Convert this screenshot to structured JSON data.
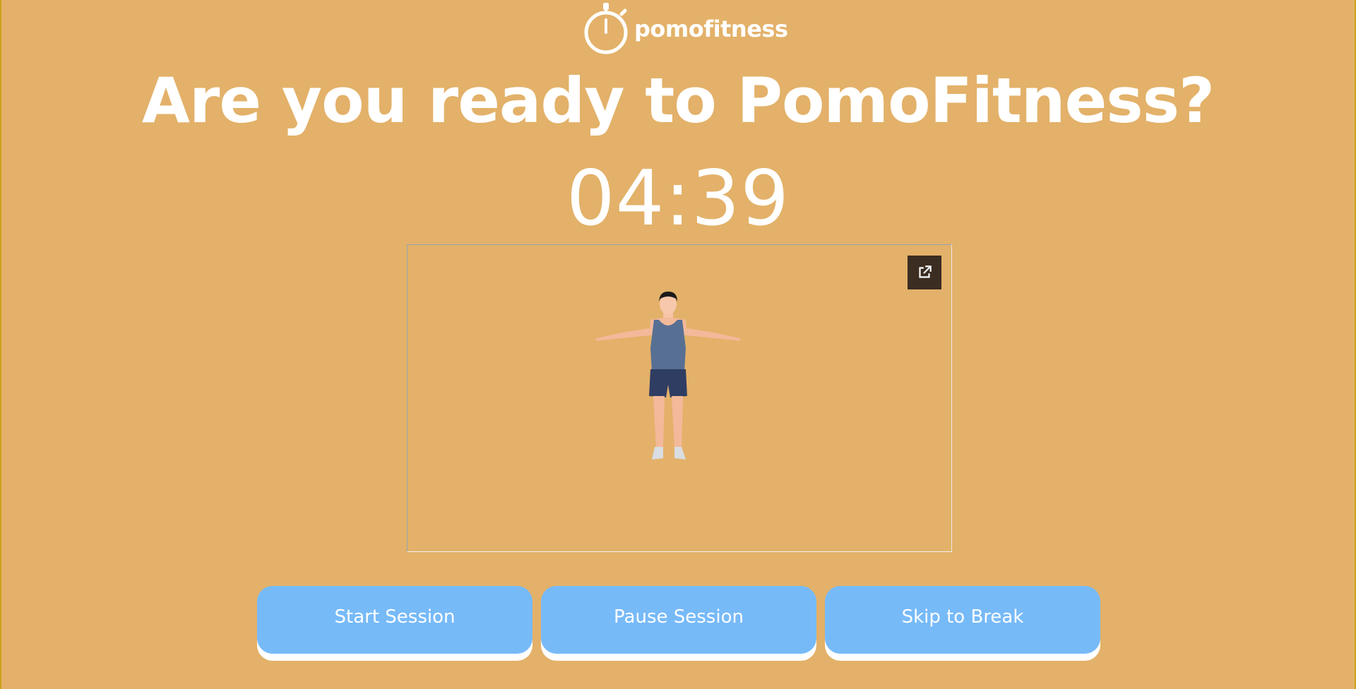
{
  "brand": {
    "name": "pomofitness",
    "logo_icon": "stopwatch-icon"
  },
  "headline": "Are you ready to PomoFitness?",
  "timer": {
    "display": "04:39"
  },
  "video": {
    "expand_icon": "open-in-new-icon",
    "figure": "exercise-figure-arms-out"
  },
  "buttons": {
    "start_label": "Start Session",
    "pause_label": "Pause Session",
    "skip_label": "Skip to Break"
  },
  "colors": {
    "background": "#e3b169",
    "button": "#77baf8",
    "text": "#ffffff",
    "expand_button": "#3b2d22"
  }
}
